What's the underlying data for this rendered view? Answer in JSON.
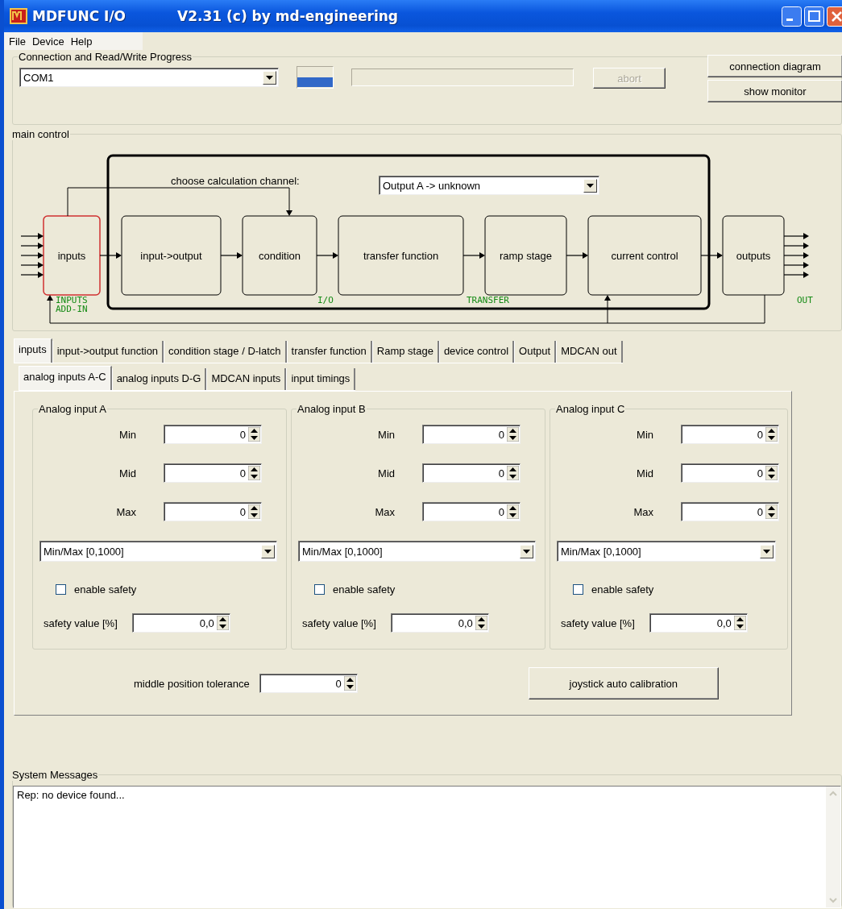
{
  "window": {
    "title": "MDFUNC I/O",
    "subtitle": "V2.31 (c) by md-engineering"
  },
  "menu": [
    "File",
    "Device",
    "Help"
  ],
  "connection": {
    "legend": "Connection and Read/Write Progress",
    "port": "COM1",
    "progress": {
      "level": 0
    },
    "abort": {
      "label": "abort",
      "disabled": true
    },
    "buttons": [
      "connection diagram",
      "show monitor"
    ]
  },
  "main_control": {
    "legend": "main control",
    "channel_label": "choose calculation channel:",
    "channel": "Output A -> unknown",
    "blocks": [
      {
        "label": "inputs",
        "selected": true
      },
      {
        "label": "input->output",
        "selected": false
      },
      {
        "label": "condition",
        "selected": false
      },
      {
        "label": "transfer function",
        "selected": false
      },
      {
        "label": "ramp stage",
        "selected": false
      },
      {
        "label": "current control",
        "selected": false
      },
      {
        "label": "outputs",
        "selected": false
      }
    ],
    "stage_labels": [
      "INPUTS",
      "ADD-IN",
      "I/O",
      "TRANSFER",
      "OUT"
    ]
  },
  "tabs": [
    {
      "label": "inputs",
      "selected": true
    },
    {
      "label": "input->output function",
      "selected": false
    },
    {
      "label": "condition stage / D-latch",
      "selected": false
    },
    {
      "label": "transfer function",
      "selected": false
    },
    {
      "label": "Ramp stage",
      "selected": false
    },
    {
      "label": "device control",
      "selected": false
    },
    {
      "label": "Output",
      "selected": false
    },
    {
      "label": "MDCAN out",
      "selected": false
    }
  ],
  "subtabs": [
    {
      "label": "analog inputs A-C",
      "selected": true
    },
    {
      "label": "analog inputs D-G",
      "selected": false
    },
    {
      "label": "MDCAN inputs",
      "selected": false
    },
    {
      "label": "input timings",
      "selected": false
    }
  ],
  "analog_inputs": [
    {
      "title": "Analog input A",
      "fields": [
        {
          "label": "Min",
          "value": "0"
        },
        {
          "label": "Mid",
          "value": "0"
        },
        {
          "label": "Max",
          "value": "0"
        }
      ],
      "mode": "Min/Max [0,1000]",
      "safety": {
        "label": "enable safety",
        "checked": false
      },
      "safety_value": {
        "label": "safety value [%]",
        "value": "0,0"
      }
    },
    {
      "title": "Analog input B",
      "fields": [
        {
          "label": "Min",
          "value": "0"
        },
        {
          "label": "Mid",
          "value": "0"
        },
        {
          "label": "Max",
          "value": "0"
        }
      ],
      "mode": "Min/Max [0,1000]",
      "safety": {
        "label": "enable safety",
        "checked": false
      },
      "safety_value": {
        "label": "safety value [%]",
        "value": "0,0"
      }
    },
    {
      "title": "Analog input C",
      "fields": [
        {
          "label": "Min",
          "value": "0"
        },
        {
          "label": "Mid",
          "value": "0"
        },
        {
          "label": "Max",
          "value": "0"
        }
      ],
      "mode": "Min/Max [0,1000]",
      "safety": {
        "label": "enable safety",
        "checked": false
      },
      "safety_value": {
        "label": "safety value [%]",
        "value": "0,0"
      }
    }
  ],
  "tolerance": {
    "label": "middle position tolerance",
    "value": "0"
  },
  "calibrate_button": "joystick auto calibration",
  "system_messages": {
    "legend": "System Messages",
    "lines": [
      "Rep: no device found..."
    ]
  }
}
